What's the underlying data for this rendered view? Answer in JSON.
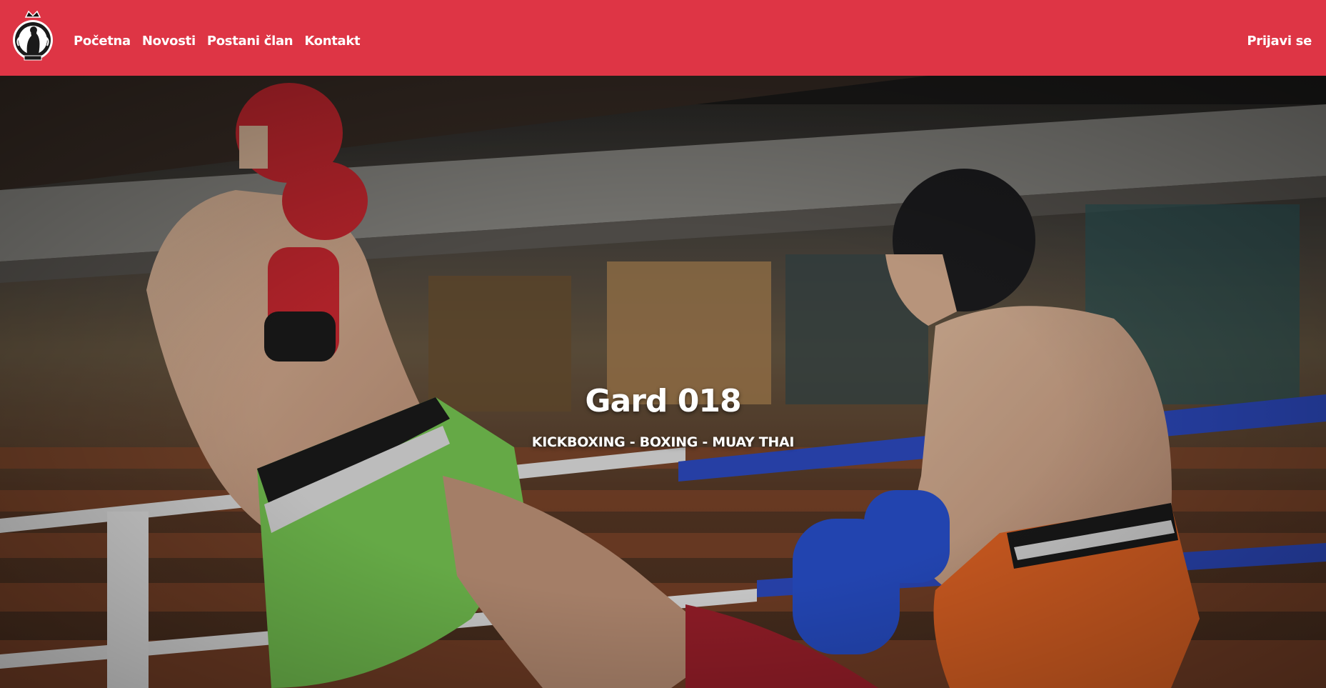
{
  "nav": {
    "logo_name": "club-crest-logo",
    "links": [
      {
        "label": "Početna"
      },
      {
        "label": "Novosti"
      },
      {
        "label": "Postani član"
      },
      {
        "label": "Kontakt"
      }
    ],
    "login_label": "Prijavi se"
  },
  "hero": {
    "title": "Gard 018",
    "subtitle": "KICKBOXING - BOXING - MUAY THAI",
    "image": "kickboxing-fight-photo"
  },
  "colors": {
    "brand_red": "#de3545",
    "text": "#ffffff"
  }
}
